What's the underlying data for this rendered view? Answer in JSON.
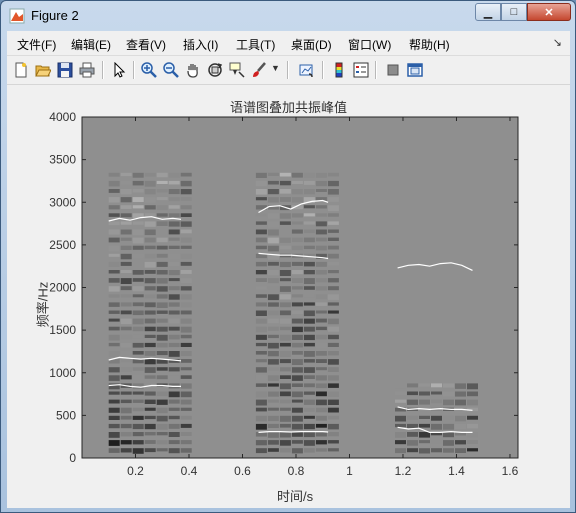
{
  "window": {
    "title": "Figure 2",
    "icon": "matlab-figure-icon"
  },
  "menu": [
    {
      "label": "文件(F)"
    },
    {
      "label": "编辑(E)"
    },
    {
      "label": "查看(V)"
    },
    {
      "label": "插入(I)"
    },
    {
      "label": "工具(T)"
    },
    {
      "label": "桌面(D)"
    },
    {
      "label": "窗口(W)"
    },
    {
      "label": "帮助(H)"
    }
  ],
  "toolbar": [
    "new-figure-icon",
    "open-file-icon",
    "save-icon",
    "print-icon",
    "pointer-icon",
    "zoom-in-icon",
    "zoom-out-icon",
    "pan-hand-icon",
    "rotate-3d-icon",
    "data-cursor-icon",
    "brush-icon",
    "link-plot-icon",
    "colorbar-icon",
    "legend-icon",
    "hide-plot-tools-icon",
    "show-plot-tools-icon"
  ],
  "plot": {
    "title": "语谱图叠加共振峰值",
    "xlabel": "时间/s",
    "ylabel": "频率/Hz"
  },
  "chart_data": {
    "type": "heatmap",
    "title": "语谱图叠加共振峰值",
    "xlabel": "时间/s",
    "ylabel": "频率/Hz",
    "xlim": [
      0,
      1.63
    ],
    "ylim": [
      0,
      4000
    ],
    "xticks": [
      0.2,
      0.4,
      0.6,
      0.8,
      1,
      1.2,
      1.4,
      1.6
    ],
    "yticks": [
      0,
      500,
      1000,
      1500,
      2000,
      2500,
      3000,
      3500,
      4000
    ],
    "colormap": "gray",
    "grid": false,
    "formant_color": "#ffffff",
    "segments": [
      {
        "t_start": 0.1,
        "t_end": 0.38,
        "f_max": 3400
      },
      {
        "t_start": 0.65,
        "t_end": 0.93,
        "f_max": 3400
      },
      {
        "t_start": 1.17,
        "t_end": 1.48,
        "f_max": 900
      }
    ],
    "series": [
      {
        "points": [
          [
            0.1,
            2780
          ],
          [
            0.14,
            2810
          ],
          [
            0.18,
            2790
          ],
          [
            0.22,
            2820
          ],
          [
            0.26,
            2830
          ],
          [
            0.3,
            2800
          ],
          [
            0.34,
            2810
          ],
          [
            0.37,
            2800
          ]
        ]
      },
      {
        "points": [
          [
            0.1,
            1150
          ],
          [
            0.14,
            1180
          ],
          [
            0.18,
            1170
          ],
          [
            0.22,
            1160
          ],
          [
            0.26,
            1170
          ],
          [
            0.3,
            1160
          ],
          [
            0.34,
            1150
          ],
          [
            0.37,
            1140
          ]
        ]
      },
      {
        "points": [
          [
            0.1,
            850
          ],
          [
            0.14,
            860
          ],
          [
            0.18,
            840
          ],
          [
            0.22,
            830
          ],
          [
            0.26,
            850
          ],
          [
            0.3,
            850
          ],
          [
            0.34,
            840
          ],
          [
            0.37,
            840
          ]
        ]
      },
      {
        "points": [
          [
            0.66,
            2880
          ],
          [
            0.7,
            2950
          ],
          [
            0.74,
            2960
          ],
          [
            0.78,
            2920
          ],
          [
            0.82,
            2980
          ],
          [
            0.86,
            3010
          ],
          [
            0.9,
            3020
          ],
          [
            0.92,
            3000
          ]
        ]
      },
      {
        "points": [
          [
            0.66,
            2400
          ],
          [
            0.7,
            2390
          ],
          [
            0.74,
            2380
          ],
          [
            0.78,
            2380
          ],
          [
            0.82,
            2370
          ],
          [
            0.86,
            2360
          ],
          [
            0.9,
            2350
          ],
          [
            0.92,
            2340
          ]
        ]
      },
      {
        "points": [
          [
            0.66,
            300
          ],
          [
            0.7,
            310
          ],
          [
            0.74,
            310
          ],
          [
            0.78,
            305
          ],
          [
            0.82,
            310
          ],
          [
            0.86,
            310
          ],
          [
            0.9,
            310
          ],
          [
            0.92,
            305
          ]
        ]
      },
      {
        "points": [
          [
            1.18,
            2230
          ],
          [
            1.22,
            2260
          ],
          [
            1.26,
            2270
          ],
          [
            1.3,
            2250
          ],
          [
            1.34,
            2280
          ],
          [
            1.38,
            2290
          ],
          [
            1.42,
            2260
          ],
          [
            1.46,
            2200
          ]
        ]
      },
      {
        "points": [
          [
            1.18,
            600
          ],
          [
            1.22,
            570
          ],
          [
            1.26,
            580
          ],
          [
            1.3,
            570
          ],
          [
            1.34,
            580
          ],
          [
            1.38,
            570
          ],
          [
            1.42,
            570
          ],
          [
            1.46,
            560
          ]
        ]
      },
      {
        "points": [
          [
            1.18,
            360
          ],
          [
            1.22,
            340
          ],
          [
            1.26,
            350
          ],
          [
            1.3,
            300
          ],
          [
            1.34,
            300
          ],
          [
            1.38,
            310
          ],
          [
            1.42,
            300
          ],
          [
            1.46,
            300
          ]
        ]
      }
    ]
  }
}
